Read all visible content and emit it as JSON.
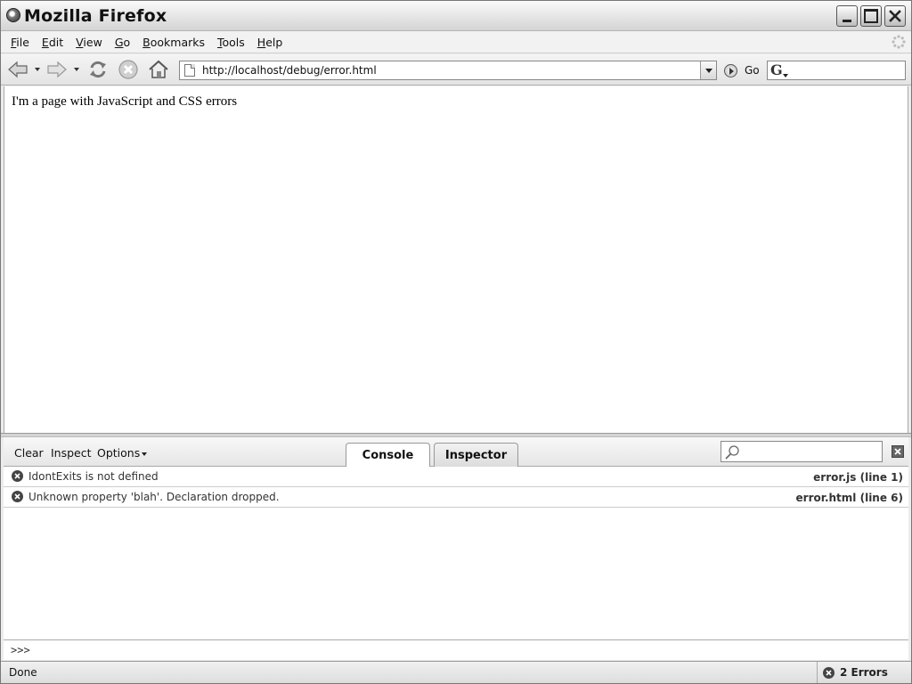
{
  "window": {
    "title": "Mozilla Firefox"
  },
  "menubar": {
    "items": [
      {
        "label": "File",
        "accel": "F",
        "rest": "ile"
      },
      {
        "label": "Edit",
        "accel": "E",
        "rest": "dit"
      },
      {
        "label": "View",
        "accel": "V",
        "rest": "iew"
      },
      {
        "label": "Go",
        "accel": "G",
        "rest": "o"
      },
      {
        "label": "Bookmarks",
        "accel": "B",
        "rest": "ookmarks"
      },
      {
        "label": "Tools",
        "accel": "T",
        "rest": "ools"
      },
      {
        "label": "Help",
        "accel": "H",
        "rest": "elp"
      }
    ]
  },
  "navbar": {
    "url": "http://localhost/debug/error.html",
    "go_label": "Go",
    "search_engine_glyph": "G"
  },
  "page": {
    "text": "I'm a page with JavaScript and CSS errors"
  },
  "firebug": {
    "commands": {
      "clear": "Clear",
      "inspect": "Inspect",
      "options": "Options"
    },
    "tabs": {
      "console": "Console",
      "inspector": "Inspector"
    },
    "console_rows": [
      {
        "message": "IdontExits is not defined",
        "source": "error.js (line 1)"
      },
      {
        "message": "Unknown property 'blah'. Declaration dropped.",
        "source": "error.html (line 6)"
      }
    ],
    "prompt": ">>>"
  },
  "statusbar": {
    "text": "Done",
    "errors": "2 Errors"
  }
}
